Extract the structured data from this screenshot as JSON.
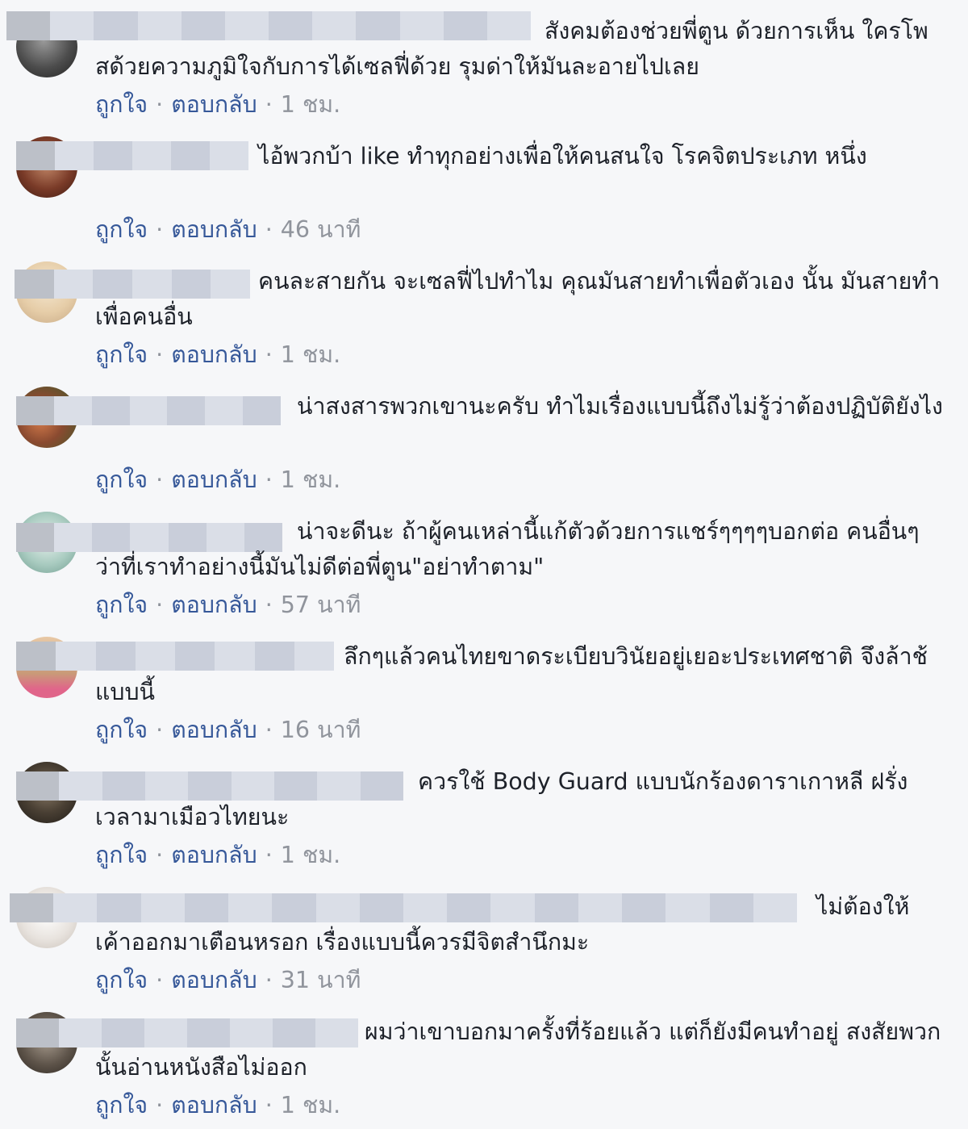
{
  "labels": {
    "like": "ถูกใจ",
    "reply": "ตอบกลับ",
    "separator": "·"
  },
  "comments": [
    {
      "text": "สังคมต้องช่วยพี่ตูน ด้วยการเห็น ใครโพสด้วยความภูมิใจกับการได้เซลฟี่ด้วย รุมด่าให้มันละอายไปเลย",
      "time": "1 ชม."
    },
    {
      "text": "ไอ้พวกบ้า like ทำทุกอย่างเพื่อให้คนสนใจ โรคจิตประเภท หนึ่ง",
      "time": "46 นาที"
    },
    {
      "text": "คนละสายกัน จะเซลฟี่ไปทำไม คุณมันสายทำเพื่อตัวเอง นั้น มันสายทำเพื่อคนอื่น",
      "time": "1 ชม."
    },
    {
      "text": "น่าสงสารพวกเขานะครับ ทำไมเรื่องแบบนี้ถึงไม่รู้ว่าต้องปฏิบัติยังไง",
      "time": "1 ชม."
    },
    {
      "text": "น่าจะดีนะ ถ้าผู้คนเหล่านี้แก้ตัวด้วยการแชร์ๆๆๆๆบอกต่อ คนอื่นๆ ว่าที่เราทำอย่างนี้มันไม่ดีต่อพี่ตูน\"อย่าทำตาม\"",
      "time": "57 นาที"
    },
    {
      "text": "ลึกๆแล้วคนไทยขาดระเบียบวินัยอยู่เยอะประเทศชาติ จึงล้าช้แบบนี้",
      "time": "16 นาที"
    },
    {
      "text": "ควรใช้ Body Guard แบบนักร้องดาราเกาหลี ฝรั่งเวลามาเมือวไทยนะ",
      "time": "1 ชม."
    },
    {
      "text": "ไม่ต้องให้ เค้าออกมาเตือนหรอก เรื่องแบบนี้ควรมีจิตสำนึกมะ",
      "time": "31 นาที"
    },
    {
      "text": "ผมว่าเขาบอกมาครั้งที่ร้อยแล้ว แต่ก็ยังมีคนทำอยู่ สงสัยพวกนั้นอ่านหนังสือไม่ออก",
      "time": "1 ชม."
    }
  ]
}
